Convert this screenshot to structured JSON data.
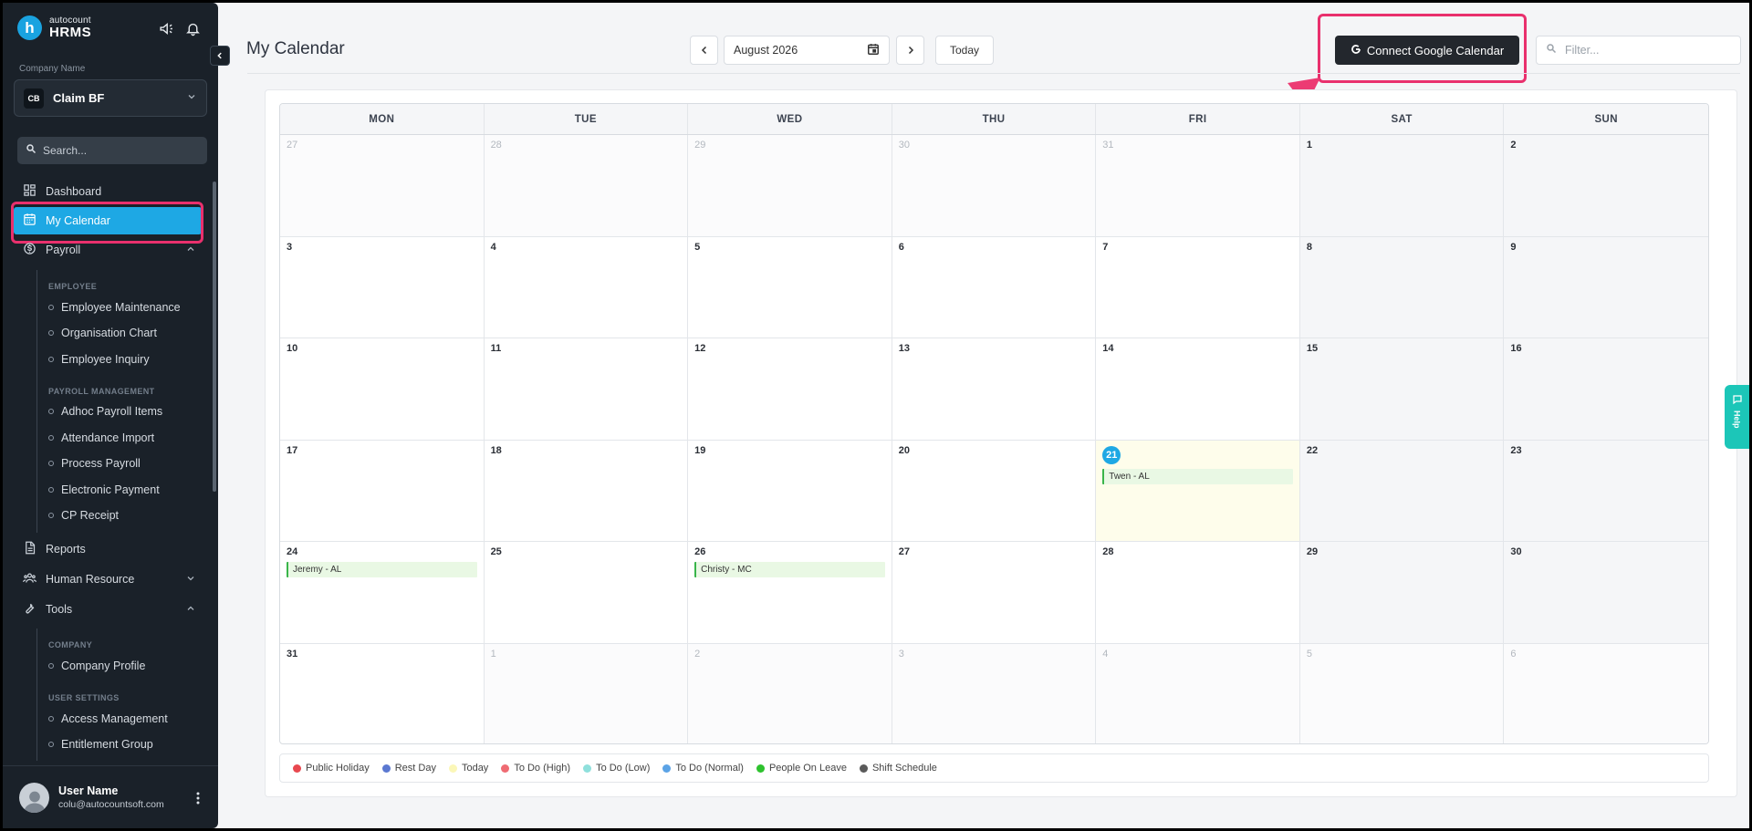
{
  "app": {
    "brand_sub": "autocount",
    "brand_main": "HRMS",
    "logo_letter": "h"
  },
  "company": {
    "label": "Company Name",
    "badge": "CB",
    "name": "Claim BF"
  },
  "sidebar_search": {
    "placeholder": "Search..."
  },
  "nav": {
    "dashboard": "Dashboard",
    "my_calendar": "My Calendar",
    "payroll": "Payroll",
    "employee_section": "EMPLOYEE",
    "employee_items": [
      "Employee Maintenance",
      "Organisation Chart",
      "Employee Inquiry"
    ],
    "payroll_mgmt_section": "PAYROLL MANAGEMENT",
    "payroll_items": [
      "Adhoc Payroll Items",
      "Attendance Import",
      "Process Payroll",
      "Electronic Payment",
      "CP Receipt"
    ],
    "reports": "Reports",
    "human_resource": "Human Resource",
    "tools": "Tools",
    "company_section": "COMPANY",
    "company_items": [
      "Company Profile"
    ],
    "user_settings_section": "USER SETTINGS",
    "user_settings_items": [
      "Access Management",
      "Entitlement Group"
    ]
  },
  "user": {
    "name": "User Name",
    "email": "colu@autocountsoft.com"
  },
  "header": {
    "title": "My Calendar",
    "month_value": "August 2026",
    "today_label": "Today",
    "google_label": "Connect Google Calendar",
    "filter_placeholder": "Filter..."
  },
  "calendar": {
    "weekdays": [
      "MON",
      "TUE",
      "WED",
      "THU",
      "FRI",
      "SAT",
      "SUN"
    ],
    "cells": [
      {
        "day": "27",
        "other": true
      },
      {
        "day": "28",
        "other": true
      },
      {
        "day": "29",
        "other": true
      },
      {
        "day": "30",
        "other": true
      },
      {
        "day": "31",
        "other": true
      },
      {
        "day": "1",
        "weekend": true
      },
      {
        "day": "2",
        "weekend": true
      },
      {
        "day": "3"
      },
      {
        "day": "4"
      },
      {
        "day": "5"
      },
      {
        "day": "6"
      },
      {
        "day": "7"
      },
      {
        "day": "8",
        "weekend": true
      },
      {
        "day": "9",
        "weekend": true
      },
      {
        "day": "10"
      },
      {
        "day": "11"
      },
      {
        "day": "12"
      },
      {
        "day": "13"
      },
      {
        "day": "14"
      },
      {
        "day": "15",
        "weekend": true
      },
      {
        "day": "16",
        "weekend": true
      },
      {
        "day": "17"
      },
      {
        "day": "18"
      },
      {
        "day": "19"
      },
      {
        "day": "20"
      },
      {
        "day": "21",
        "today": true,
        "events": [
          "Twen - AL"
        ]
      },
      {
        "day": "22",
        "weekend": true
      },
      {
        "day": "23",
        "weekend": true
      },
      {
        "day": "24",
        "events": [
          "Jeremy - AL"
        ]
      },
      {
        "day": "25"
      },
      {
        "day": "26",
        "events": [
          "Christy - MC"
        ]
      },
      {
        "day": "27"
      },
      {
        "day": "28"
      },
      {
        "day": "29",
        "weekend": true
      },
      {
        "day": "30",
        "weekend": true
      },
      {
        "day": "31"
      },
      {
        "day": "1",
        "other": true
      },
      {
        "day": "2",
        "other": true
      },
      {
        "day": "3",
        "other": true
      },
      {
        "day": "4",
        "other": true
      },
      {
        "day": "5",
        "other": true
      },
      {
        "day": "6",
        "other": true
      }
    ]
  },
  "legend": [
    {
      "label": "Public Holiday",
      "color": "#e8484f"
    },
    {
      "label": "Rest Day",
      "color": "#5b78d1"
    },
    {
      "label": "Today",
      "color": "#fbf7b8"
    },
    {
      "label": "To Do (High)",
      "color": "#ef6b73"
    },
    {
      "label": "To Do (Low)",
      "color": "#8fe0dc"
    },
    {
      "label": "To Do (Normal)",
      "color": "#5ba3e6"
    },
    {
      "label": "People On Leave",
      "color": "#2ec22e"
    },
    {
      "label": "Shift Schedule",
      "color": "#5a5a5a"
    }
  ],
  "help": {
    "label": "Help"
  }
}
